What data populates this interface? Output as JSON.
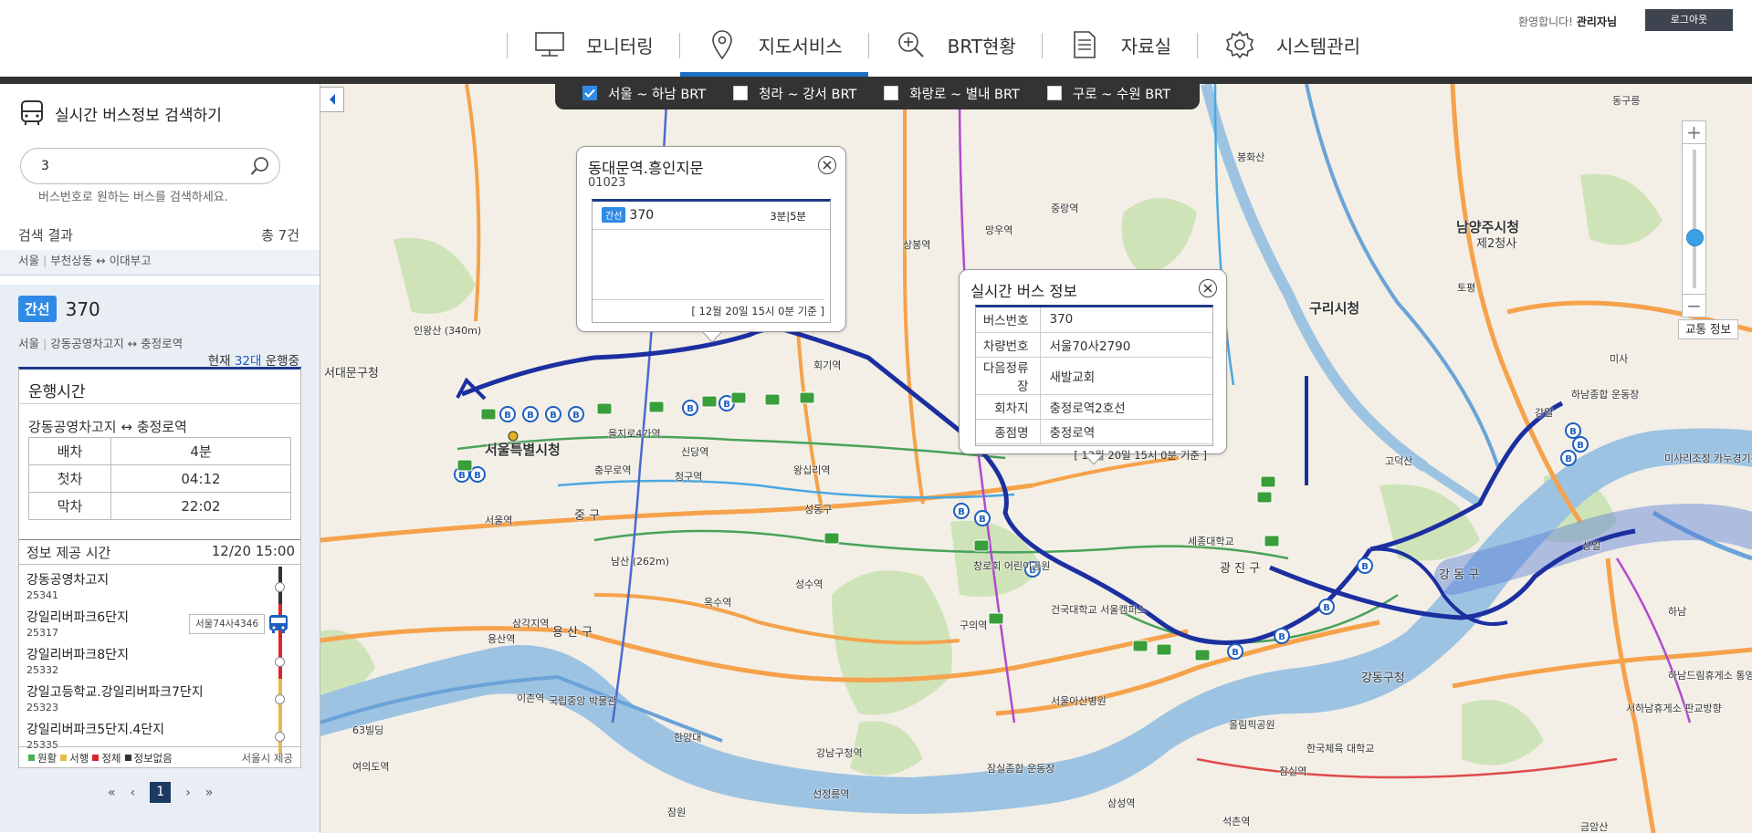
{
  "header": {
    "nav": [
      {
        "label": "모니터링",
        "icon": "monitor-icon"
      },
      {
        "label": "지도서비스",
        "icon": "map-pin-icon",
        "active": true
      },
      {
        "label": "BRT현황",
        "icon": "zoom-in-icon"
      },
      {
        "label": "자료실",
        "icon": "document-icon"
      },
      {
        "label": "시스템관리",
        "icon": "gear-icon"
      }
    ],
    "greeting_prefix": "환영합니다!",
    "user": "관리자님",
    "logout": "로그아웃"
  },
  "panel": {
    "title": "실시간 버스정보 검색하기",
    "search_value": "3",
    "search_hint": "버스번호로 원하는 버스를 검색하세요.",
    "results_label": "검색 결과",
    "results_count": "총 7건",
    "prev_result": {
      "region": "서울",
      "route": "부천상동 ↔ 이대부고"
    },
    "selected": {
      "badge": "간선",
      "number": "370",
      "region": "서울",
      "route": "강동공영차고지 ↔ 충정로역",
      "running_prefix": "현재",
      "running_count": "32대",
      "running_suffix": "운행중",
      "card_title": "운행시간",
      "direction": "강동공영차고지 ↔ 충정로역",
      "schedule": [
        {
          "label": "배차",
          "value": "4분"
        },
        {
          "label": "첫차",
          "value": "04:12"
        },
        {
          "label": "막차",
          "value": "22:02"
        }
      ],
      "info_label": "정보 제공 시간",
      "info_time": "12/20 15:00",
      "stops": [
        {
          "name": "강동공영차고지",
          "id": "25341"
        },
        {
          "name": "강일리버파크6단지",
          "id": "25317"
        },
        {
          "name": "강일리버파크8단지",
          "id": "25332"
        },
        {
          "name": "강일고등학교.강일리버파크7단지",
          "id": "25323"
        },
        {
          "name": "강일리버파크5단지.4단지",
          "id": "25335"
        }
      ],
      "bus_plate": "서울74사4346",
      "legend": [
        {
          "label": "원활",
          "color": "#4caf50"
        },
        {
          "label": "서행",
          "color": "#e8b84a"
        },
        {
          "label": "정체",
          "color": "#d9262c"
        },
        {
          "label": "정보없음",
          "color": "#333333"
        }
      ],
      "provider": "서울시 제공"
    },
    "pager": {
      "first": "«",
      "prev": "‹",
      "current": "1",
      "next": "›",
      "last": "»"
    }
  },
  "brt_filters": [
    {
      "label": "서울 ~ 하남 BRT",
      "checked": true
    },
    {
      "label": "청라 ~ 강서 BRT",
      "checked": false
    },
    {
      "label": "화랑로 ~ 별내 BRT",
      "checked": false
    },
    {
      "label": "구로 ~ 수원 BRT",
      "checked": false
    }
  ],
  "map": {
    "traffic_button": "교통 정보",
    "labels": [
      {
        "text": "서울특별시청",
        "cls": "big"
      },
      {
        "text": "구리시청",
        "cls": "mid"
      },
      {
        "text": "남양주시청",
        "cls": "mid"
      },
      {
        "text": "제2청사",
        "cls": "mid"
      },
      {
        "text": "서대문구청",
        "cls": "mid"
      },
      {
        "text": "강동구청",
        "cls": "mid"
      },
      {
        "text": "광 진 구",
        "cls": "mid"
      },
      {
        "text": "강 동 구",
        "cls": "mid"
      },
      {
        "text": "용 산 구",
        "cls": "mid"
      },
      {
        "text": "중 구",
        "cls": "mid"
      },
      {
        "text": "세종대학교",
        "cls": ""
      },
      {
        "text": "을지로4가역",
        "cls": ""
      },
      {
        "text": "신당역",
        "cls": ""
      },
      {
        "text": "청구역",
        "cls": ""
      },
      {
        "text": "왕십리역",
        "cls": ""
      },
      {
        "text": "충무로역",
        "cls": ""
      },
      {
        "text": "남산 (262m)",
        "cls": ""
      },
      {
        "text": "국립중앙 박물관",
        "cls": ""
      },
      {
        "text": "서울아산병원",
        "cls": ""
      },
      {
        "text": "올림픽공원",
        "cls": ""
      },
      {
        "text": "한국체육 대학교",
        "cls": ""
      },
      {
        "text": "잠실역",
        "cls": ""
      },
      {
        "text": "강남구청역",
        "cls": ""
      },
      {
        "text": "선정릉역",
        "cls": ""
      },
      {
        "text": "서울역",
        "cls": ""
      },
      {
        "text": "회기역",
        "cls": ""
      },
      {
        "text": "망우역",
        "cls": ""
      },
      {
        "text": "상봉역",
        "cls": ""
      },
      {
        "text": "중랑역",
        "cls": ""
      },
      {
        "text": "하남종합 운동장",
        "cls": ""
      },
      {
        "text": "고덕산",
        "cls": ""
      },
      {
        "text": "미사리조정 카누경기장",
        "cls": ""
      },
      {
        "text": "하남드림휴게소 통영방향",
        "cls": ""
      },
      {
        "text": "서하남휴게소 판교방향",
        "cls": ""
      },
      {
        "text": "인왕산 (340m)",
        "cls": ""
      },
      {
        "text": "용산역",
        "cls": ""
      },
      {
        "text": "여의도역",
        "cls": ""
      },
      {
        "text": "63빌딩",
        "cls": ""
      },
      {
        "text": "삼각지역",
        "cls": ""
      },
      {
        "text": "이촌역",
        "cls": ""
      },
      {
        "text": "옥수역",
        "cls": ""
      },
      {
        "text": "성수역",
        "cls": ""
      },
      {
        "text": "구의역",
        "cls": ""
      },
      {
        "text": "건국대학교 서울캠퍼스",
        "cls": ""
      },
      {
        "text": "창로회 어린이공원",
        "cls": ""
      },
      {
        "text": "잠실종합 운동장",
        "cls": ""
      },
      {
        "text": "동구릉",
        "cls": ""
      },
      {
        "text": "봉화산",
        "cls": ""
      },
      {
        "text": "토평",
        "cls": ""
      },
      {
        "text": "미사",
        "cls": ""
      },
      {
        "text": "강일",
        "cls": ""
      },
      {
        "text": "상일",
        "cls": ""
      },
      {
        "text": "하남",
        "cls": ""
      },
      {
        "text": "금암산",
        "cls": ""
      },
      {
        "text": "성동구",
        "cls": ""
      },
      {
        "text": "한양대",
        "cls": ""
      },
      {
        "text": "잠원",
        "cls": ""
      },
      {
        "text": "석촌역",
        "cls": ""
      },
      {
        "text": "삼성역",
        "cls": ""
      }
    ]
  },
  "popup_stop": {
    "title": "동대문역.흥인지문",
    "code": "01023",
    "badge": "간선",
    "route": "370",
    "eta": "3분|5분",
    "stamp": "[ 12월 20일 15시 0분 기준 ]"
  },
  "popup_bus": {
    "title": "실시간 버스 정보",
    "rows": [
      {
        "k": "버스번호",
        "v": "370"
      },
      {
        "k": "차량번호",
        "v": "서울70사2790"
      },
      {
        "k": "다음정류장",
        "v": "새발교회"
      },
      {
        "k": "회차지",
        "v": "충정로역2호선"
      },
      {
        "k": "종점명",
        "v": "충정로역"
      }
    ],
    "stamp": "[ 12월 20일 15시 0분 기준 ]"
  }
}
